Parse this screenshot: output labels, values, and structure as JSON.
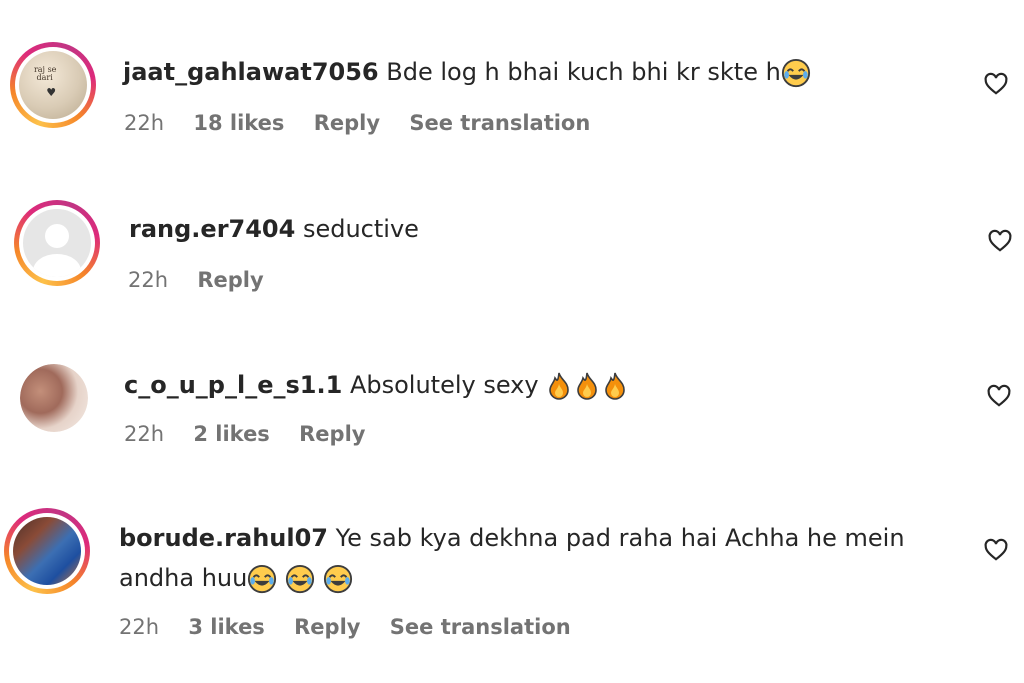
{
  "comments": [
    {
      "username": "jaat_gahlawat7056",
      "text": "Bde log h bhai kuch bhi kr skte h",
      "emoji": [
        "face-with-tears-of-joy"
      ],
      "time": "22h",
      "likes": "18 likes",
      "reply": "Reply",
      "translate": "See translation",
      "avatar_ring": true,
      "avatar_text": "raj se\ndari"
    },
    {
      "username": "rang.er7404",
      "text": "seductive",
      "emoji": [],
      "time": "22h",
      "likes": "",
      "reply": "Reply",
      "translate": "",
      "avatar_ring": true
    },
    {
      "username": "c_o_u_p_l_e_s1.1",
      "text": "Absolutely sexy",
      "emoji": [
        "fire",
        "fire",
        "fire"
      ],
      "time": "22h",
      "likes": "2 likes",
      "reply": "Reply",
      "translate": "",
      "avatar_ring": false
    },
    {
      "username": "borude.rahul07",
      "text_line1": "Ye sab kya dekhna pad raha hai Achha he mein",
      "text_line2": "andha huu",
      "emoji": [
        "face-with-tears-of-joy",
        "face-with-tears-of-joy",
        "face-with-tears-of-joy"
      ],
      "time": "22h",
      "likes": "3 likes",
      "reply": "Reply",
      "translate": "See translation",
      "avatar_ring": true
    }
  ],
  "colors": {
    "text": "#262626",
    "meta": "#737373",
    "ring_start": "#fdc14a",
    "ring_mid": "#dd2a7b",
    "ring_end": "#f58529"
  }
}
